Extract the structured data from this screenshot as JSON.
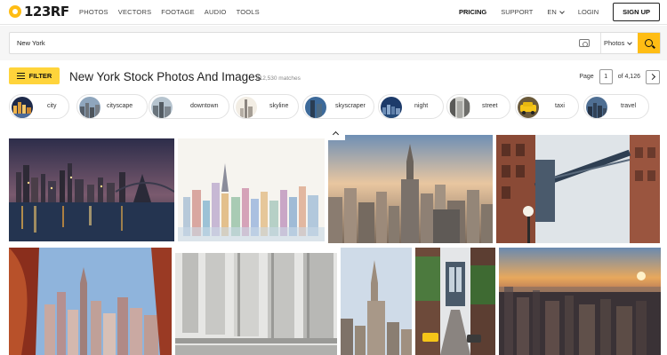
{
  "header": {
    "logo_text": "123RF",
    "nav": [
      "PHOTOS",
      "VECTORS",
      "FOOTAGE",
      "AUDIO",
      "TOOLS"
    ],
    "pricing": "PRICING",
    "support": "SUPPORT",
    "language": "EN",
    "login": "LOGIN",
    "signup": "SIGN UP"
  },
  "search": {
    "value": "New York",
    "type": "Photos",
    "accent": "#ffbd14"
  },
  "results": {
    "filter_label": "FILTER",
    "title": "New York Stock Photos And Images",
    "matches": "412,530 matches",
    "page_label": "Page",
    "page_value": "1",
    "page_total": "of 4,126"
  },
  "chips": [
    {
      "label": "city",
      "icon": "city-night-thumb"
    },
    {
      "label": "cityscape",
      "icon": "cityscape-thumb"
    },
    {
      "label": "downtown",
      "icon": "downtown-thumb"
    },
    {
      "label": "skyline",
      "icon": "skyline-thumb"
    },
    {
      "label": "skyscraper",
      "icon": "skyscraper-thumb"
    },
    {
      "label": "night",
      "icon": "night-thumb"
    },
    {
      "label": "street",
      "icon": "street-thumb"
    },
    {
      "label": "taxi",
      "icon": "taxi-thumb"
    },
    {
      "label": "travel",
      "icon": "travel-thumb"
    }
  ]
}
